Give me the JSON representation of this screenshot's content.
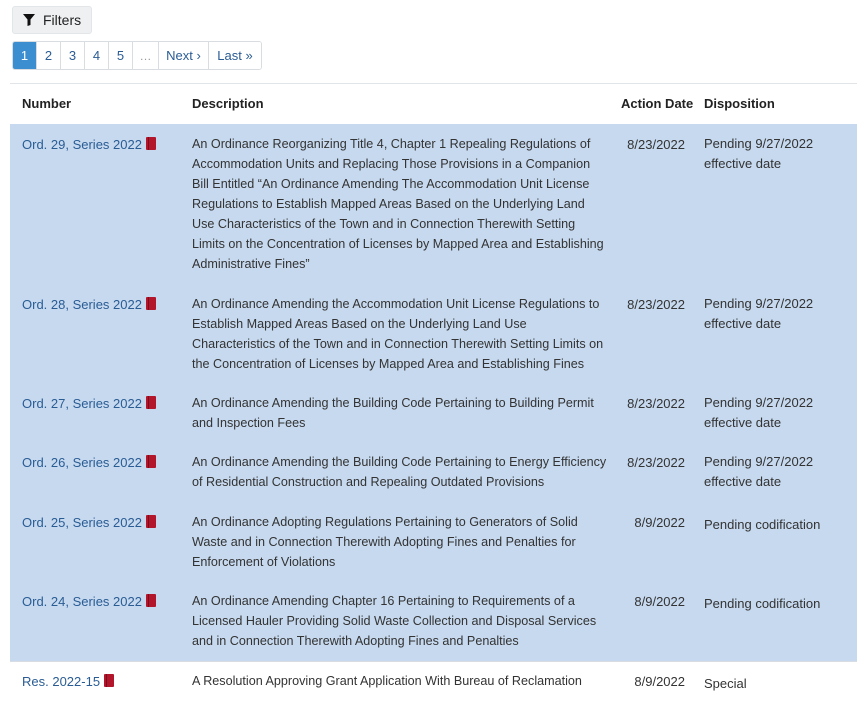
{
  "filters": {
    "label": "Filters",
    "icon": "filter-icon"
  },
  "pagination": {
    "pages": [
      "1",
      "2",
      "3",
      "4",
      "5"
    ],
    "active": "1",
    "ellipsis": "…",
    "next": "Next ›",
    "last": "Last »"
  },
  "table": {
    "headers": {
      "number": "Number",
      "description": "Description",
      "action_date": "Action Date",
      "disposition": "Disposition"
    },
    "rows": [
      {
        "number": "Ord. 29, Series 2022",
        "description": "An Ordinance Reorganizing Title 4, Chapter 1 Repealing Regulations of Accommodation Units and Replacing Those Provisions in a Companion Bill Entitled “An Ordinance Amending The Accommodation Unit License Regulations to Establish Mapped Areas Based on the Underlying Land Use Characteristics of the Town and in Connection Therewith Setting Limits on the Concentration of Licenses by Mapped Area and Establishing Administrative Fines”",
        "action_date": "8/23/2022",
        "disposition": "Pending 9/27/2022 effective date",
        "selected": true
      },
      {
        "number": "Ord. 28, Series 2022",
        "description": "An Ordinance Amending the Accommodation Unit License Regulations to Establish Mapped Areas Based on the Underlying Land Use Characteristics of the Town and in Connection Therewith Setting Limits on the Concentration of Licenses by Mapped Area and Establishing Fines",
        "action_date": "8/23/2022",
        "disposition": "Pending 9/27/2022 effective date",
        "selected": true
      },
      {
        "number": "Ord. 27, Series 2022",
        "description": "An Ordinance Amending the Building Code Pertaining to Building Permit and Inspection Fees",
        "action_date": "8/23/2022",
        "disposition": "Pending 9/27/2022 effective date",
        "selected": true
      },
      {
        "number": "Ord. 26, Series 2022",
        "description": "An Ordinance Amending the Building Code Pertaining to Energy Efficiency of Residential Construction and Repealing Outdated Provisions",
        "action_date": "8/23/2022",
        "disposition": "Pending 9/27/2022 effective date",
        "selected": true
      },
      {
        "number": "Ord. 25, Series 2022",
        "description": "An Ordinance Adopting Regulations Pertaining to Generators of Solid Waste and in Connection Therewith Adopting Fines and Penalties for Enforcement of Violations",
        "action_date": "8/9/2022",
        "disposition": "Pending codification",
        "selected": true
      },
      {
        "number": "Ord. 24, Series 2022",
        "description": "An Ordinance Amending Chapter 16 Pertaining to Requirements of a Licensed Hauler Providing Solid Waste Collection and Disposal Services and in Connection Therewith Adopting Fines and Penalties",
        "action_date": "8/9/2022",
        "disposition": "Pending codification",
        "selected": true
      },
      {
        "number": "Res. 2022-15",
        "description": "A Resolution Approving Grant Application With Bureau of Reclamation",
        "action_date": "8/9/2022",
        "disposition": "Special",
        "selected": false
      }
    ]
  },
  "colors": {
    "link": "#2a5c94",
    "selected_row": "#c6d9ef",
    "active_page": "#3b8fd0",
    "document_icon": "#b3162b"
  }
}
